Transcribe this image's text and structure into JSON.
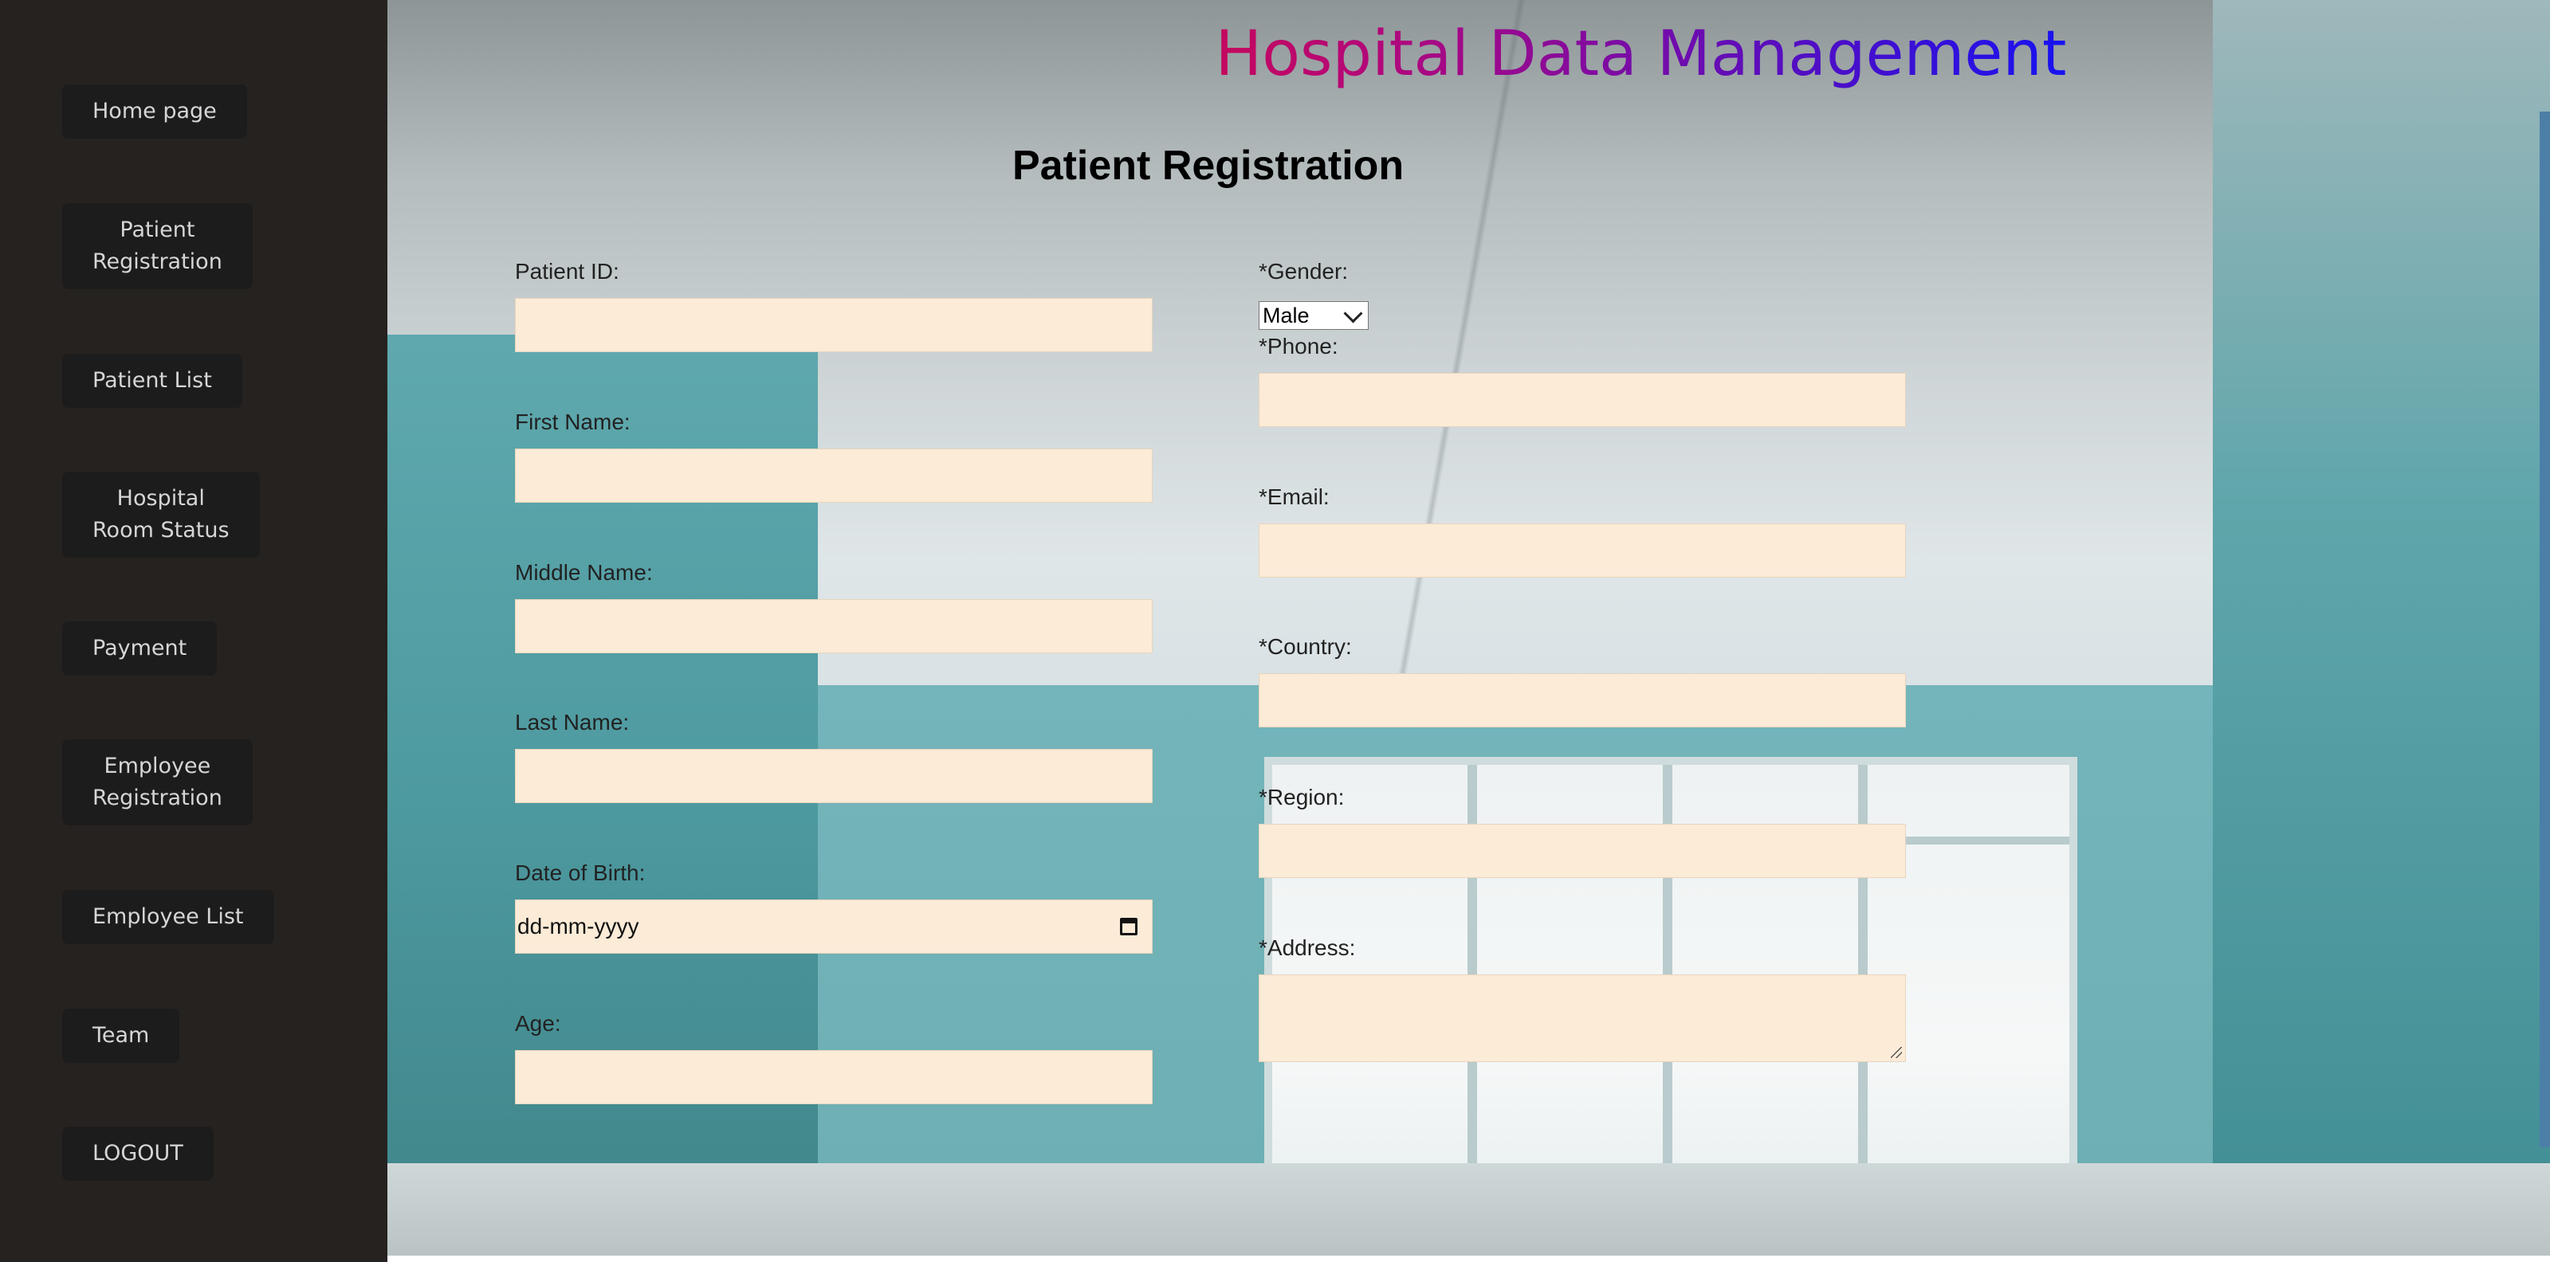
{
  "sidebar": {
    "items": [
      {
        "label": "Home page"
      },
      {
        "label": "Patient\nRegistration"
      },
      {
        "label": "Patient List"
      },
      {
        "label": "Hospital\nRoom Status"
      },
      {
        "label": "Payment"
      },
      {
        "label": "Employee\nRegistration"
      },
      {
        "label": "Employee List"
      },
      {
        "label": "Team"
      },
      {
        "label": "LOGOUT"
      }
    ]
  },
  "header": {
    "title": "Hospital Data Management"
  },
  "form": {
    "title": "Patient Registration",
    "left": {
      "patient_id": {
        "label": "Patient ID:",
        "value": ""
      },
      "first_name": {
        "label": "First Name:",
        "value": ""
      },
      "middle_name": {
        "label": "Middle Name:",
        "value": ""
      },
      "last_name": {
        "label": "Last Name:",
        "value": ""
      },
      "dob": {
        "label": "Date of Birth:",
        "value": "dd-mm-yyyy"
      },
      "age": {
        "label": "Age:",
        "value": ""
      }
    },
    "right": {
      "gender": {
        "label": "*Gender:",
        "value": "Male"
      },
      "phone": {
        "label": "*Phone:",
        "value": ""
      },
      "email": {
        "label": "*Email:",
        "value": ""
      },
      "country": {
        "label": "*Country:",
        "value": ""
      },
      "region": {
        "label": "*Region:",
        "value": ""
      },
      "address": {
        "label": "*Address:",
        "value": ""
      }
    }
  },
  "colors": {
    "sidebar_bg": "#262220",
    "button_bg": "#1c1c1c",
    "input_bg": "#fbebd7",
    "title_gradient_start": "#ef0a1a",
    "title_gradient_end": "#1712f0"
  },
  "icons": {
    "calendar": "calendar-icon",
    "dropdown": "chevron-down-icon",
    "resize": "resize-grip-icon"
  }
}
